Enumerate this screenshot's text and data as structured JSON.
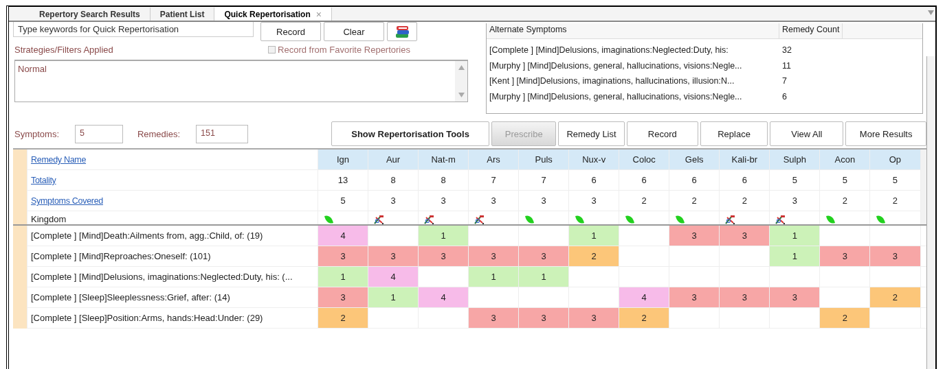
{
  "tabs": [
    {
      "label": "Repertory Search Results",
      "selected": false
    },
    {
      "label": "Patient List",
      "selected": false
    },
    {
      "label": "Quick Repertorisation",
      "selected": true,
      "close": "×"
    }
  ],
  "search": {
    "placeholder": "Type keywords for Quick Repertorisation"
  },
  "search_buttons": [
    {
      "label": "Record"
    },
    {
      "label": "Clear"
    }
  ],
  "favorites_checkbox": {
    "label": "Record from Favorite Repertories",
    "checked": false,
    "disabled": true
  },
  "strategies": {
    "label": "Strategies/Filters Applied",
    "value": "Normal"
  },
  "alternate_symptoms": {
    "columns": [
      "Alternate Symptoms",
      "Remedy Count"
    ],
    "rows": [
      {
        "symptom": "[Complete ] [Mind]Delusions, imaginations:Neglected:Duty, his:",
        "count": "32"
      },
      {
        "symptom": "[Murphy ] [Mind]Delusions, general, hallucinations, visions:Negle...",
        "count": "11"
      },
      {
        "symptom": "[Kent ] [Mind]Delusions, imaginations, hallucinations, illusion:N...",
        "count": "7"
      },
      {
        "symptom": "[Murphy ] [Mind]Delusions, general, hallucinations, visions:Negle...",
        "count": "6"
      }
    ]
  },
  "counts": {
    "symptoms_label": "Symptoms:",
    "symptoms": "5",
    "remedies_label": "Remedies:",
    "remedies": "151"
  },
  "toolbar": [
    {
      "label": "Show Repertorisation Tools",
      "kind": "primary",
      "disabled": false
    },
    {
      "label": "Prescribe",
      "kind": "normal",
      "disabled": true
    },
    {
      "label": "Remedy List",
      "kind": "normal",
      "disabled": false
    },
    {
      "label": "Record",
      "kind": "normal",
      "disabled": false
    },
    {
      "label": "Replace",
      "kind": "normal",
      "disabled": false
    },
    {
      "label": "View All",
      "kind": "normal",
      "disabled": false
    },
    {
      "label": "More Results",
      "kind": "normal",
      "disabled": false
    }
  ],
  "grid": {
    "row_headers": [
      "Remedy Name",
      "Totality",
      "Symptoms Covered",
      "Kingdom"
    ],
    "remedies": [
      {
        "name": "Ign",
        "totality": "13",
        "covered": "5",
        "kind": "plant"
      },
      {
        "name": "Aur",
        "totality": "8",
        "covered": "3",
        "kind": "mineral"
      },
      {
        "name": "Nat-m",
        "totality": "8",
        "covered": "3",
        "kind": "mineral"
      },
      {
        "name": "Ars",
        "totality": "7",
        "covered": "3",
        "kind": "mineral"
      },
      {
        "name": "Puls",
        "totality": "7",
        "covered": "3",
        "kind": "plant"
      },
      {
        "name": "Nux-v",
        "totality": "6",
        "covered": "3",
        "kind": "plant"
      },
      {
        "name": "Coloc",
        "totality": "6",
        "covered": "2",
        "kind": "plant"
      },
      {
        "name": "Gels",
        "totality": "6",
        "covered": "2",
        "kind": "plant"
      },
      {
        "name": "Kali-br",
        "totality": "6",
        "covered": "2",
        "kind": "mineral"
      },
      {
        "name": "Sulph",
        "totality": "5",
        "covered": "3",
        "kind": "mineral"
      },
      {
        "name": "Acon",
        "totality": "5",
        "covered": "2",
        "kind": "plant"
      },
      {
        "name": "Op",
        "totality": "5",
        "covered": "2",
        "kind": "plant"
      }
    ],
    "rows": [
      {
        "symptom": "[Complete ] [Mind]Death:Ailments from, agg.:Child, of: (19)",
        "grades": [
          {
            "kind": "grade",
            "value": "4",
            "color": "#f7bbe9"
          },
          {
            "kind": "empty"
          },
          {
            "kind": "grade",
            "value": "1",
            "color": "#ccf2b8"
          },
          {
            "kind": "empty"
          },
          {
            "kind": "empty"
          },
          {
            "kind": "grade",
            "value": "1",
            "color": "#ccf2b8"
          },
          {
            "kind": "empty"
          },
          {
            "kind": "grade",
            "value": "3",
            "color": "#f7a6a6"
          },
          {
            "kind": "grade",
            "value": "3",
            "color": "#f7a6a6"
          },
          {
            "kind": "grade",
            "value": "1",
            "color": "#ccf2b8"
          },
          {
            "kind": "empty"
          },
          {
            "kind": "empty"
          }
        ]
      },
      {
        "symptom": "[Complete ] [Mind]Reproaches:Oneself: (101)",
        "grades": [
          {
            "kind": "grade",
            "value": "3",
            "color": "#f7a6a6"
          },
          {
            "kind": "grade",
            "value": "3",
            "color": "#f7a6a6"
          },
          {
            "kind": "grade",
            "value": "3",
            "color": "#f7a6a6"
          },
          {
            "kind": "grade",
            "value": "3",
            "color": "#f7a6a6"
          },
          {
            "kind": "grade",
            "value": "3",
            "color": "#f7a6a6"
          },
          {
            "kind": "grade",
            "value": "2",
            "color": "#fcc679"
          },
          {
            "kind": "empty"
          },
          {
            "kind": "empty"
          },
          {
            "kind": "empty"
          },
          {
            "kind": "grade",
            "value": "1",
            "color": "#ccf2b8"
          },
          {
            "kind": "grade",
            "value": "3",
            "color": "#f7a6a6"
          },
          {
            "kind": "grade",
            "value": "3",
            "color": "#f7a6a6"
          }
        ]
      },
      {
        "symptom": "[Complete ] [Mind]Delusions, imaginations:Neglected:Duty, his: (...",
        "grades": [
          {
            "kind": "grade",
            "value": "1",
            "color": "#ccf2b8"
          },
          {
            "kind": "grade",
            "value": "4",
            "color": "#f7bbe9"
          },
          {
            "kind": "empty"
          },
          {
            "kind": "grade",
            "value": "1",
            "color": "#ccf2b8"
          },
          {
            "kind": "grade",
            "value": "1",
            "color": "#ccf2b8"
          },
          {
            "kind": "empty"
          },
          {
            "kind": "empty"
          },
          {
            "kind": "empty"
          },
          {
            "kind": "empty"
          },
          {
            "kind": "empty"
          },
          {
            "kind": "empty"
          },
          {
            "kind": "empty"
          }
        ]
      },
      {
        "symptom": "[Complete ] [Sleep]Sleeplessness:Grief, after: (14)",
        "grades": [
          {
            "kind": "grade",
            "value": "3",
            "color": "#f7a6a6"
          },
          {
            "kind": "grade",
            "value": "1",
            "color": "#ccf2b8"
          },
          {
            "kind": "grade",
            "value": "4",
            "color": "#f7bbe9"
          },
          {
            "kind": "empty"
          },
          {
            "kind": "empty"
          },
          {
            "kind": "empty"
          },
          {
            "kind": "grade",
            "value": "4",
            "color": "#f7bbe9"
          },
          {
            "kind": "grade",
            "value": "3",
            "color": "#f7a6a6"
          },
          {
            "kind": "grade",
            "value": "3",
            "color": "#f7a6a6"
          },
          {
            "kind": "grade",
            "value": "3",
            "color": "#f7a6a6"
          },
          {
            "kind": "empty"
          },
          {
            "kind": "grade",
            "value": "2",
            "color": "#fcc679"
          }
        ]
      },
      {
        "symptom": "[Complete ] [Sleep]Position:Arms, hands:Head:Under: (29)",
        "grades": [
          {
            "kind": "grade",
            "value": "2",
            "color": "#fcc679"
          },
          {
            "kind": "empty"
          },
          {
            "kind": "empty"
          },
          {
            "kind": "grade",
            "value": "3",
            "color": "#f7a6a6"
          },
          {
            "kind": "grade",
            "value": "3",
            "color": "#f7a6a6"
          },
          {
            "kind": "grade",
            "value": "3",
            "color": "#f7a6a6"
          },
          {
            "kind": "grade",
            "value": "2",
            "color": "#fcc679"
          },
          {
            "kind": "empty"
          },
          {
            "kind": "empty"
          },
          {
            "kind": "empty"
          },
          {
            "kind": "grade",
            "value": "2",
            "color": "#fcc679"
          },
          {
            "kind": "empty"
          }
        ]
      }
    ]
  }
}
